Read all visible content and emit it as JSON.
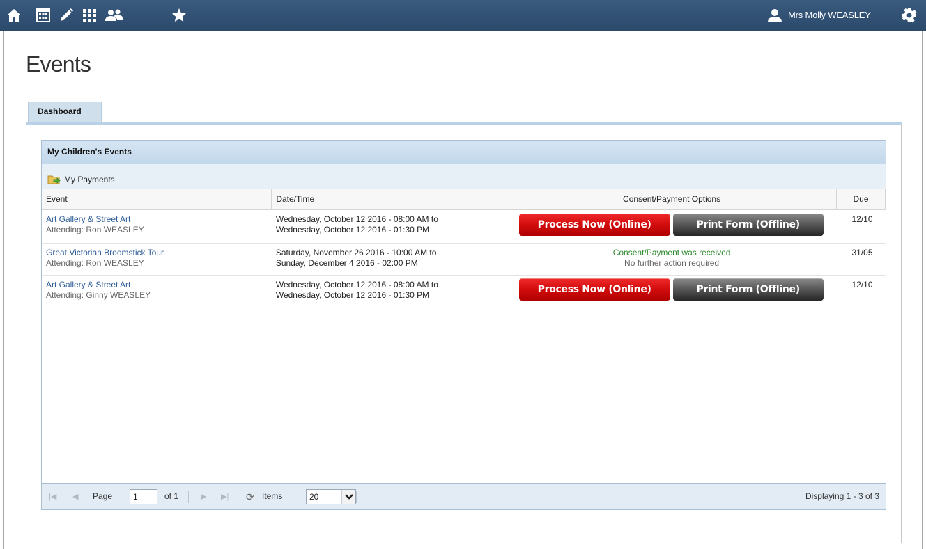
{
  "topbar": {
    "icons": [
      "home-icon",
      "calendar-icon",
      "pencil-icon",
      "grid-icon",
      "people-icon",
      "star-icon"
    ],
    "user_name": "Mrs Molly WEASLEY",
    "settings_icon": "gear-icon",
    "bar_color": "#2e4f73"
  },
  "page": {
    "title": "Events"
  },
  "tabs": [
    {
      "label": "Dashboard",
      "active": true
    }
  ],
  "grid": {
    "title": "My Children's Events",
    "toolbar_link": "My Payments",
    "columns": [
      "Event",
      "Date/Time",
      "Consent/Payment Options",
      "Due"
    ],
    "rows": [
      {
        "event": "Art Gallery & Street Art",
        "attending": "Attending: Ron WEASLEY",
        "datetime_start": "Wednesday, October 12 2016 - 08:00 AM to",
        "datetime_end": "Wednesday, October 12 2016 - 01:30 PM",
        "button_online": "Process Now (Online)",
        "button_offline": "Print Form (Offline)",
        "due": "12/10"
      },
      {
        "event": "Great Victorian Broomstick Tour",
        "attending": "Attending: Ron WEASLEY",
        "datetime_start": "Saturday, November 26 2016 - 10:00 AM to",
        "datetime_end": "Sunday, December 4 2016 - 02:00 PM",
        "consent_status": "Consent/Payment was received",
        "consent_note": "No further action required",
        "due": "31/05"
      },
      {
        "event": "Art Gallery & Street Art",
        "attending": "Attending: Ginny WEASLEY",
        "datetime_start": "Wednesday, October 12 2016 - 08:00 AM to",
        "datetime_end": "Wednesday, October 12 2016 - 01:30 PM",
        "button_online": "Process Now (Online)",
        "button_offline": "Print Form (Offline)",
        "due": "12/10"
      }
    ],
    "pager": {
      "page_label": "Page",
      "page_value": "1",
      "of_label": "of 1",
      "items_label": "Items",
      "items_value": "20",
      "displaying": "Displaying 1 - 3 of 3"
    },
    "colors": {
      "online_button": "#d10c0c",
      "offline_button": "#444444",
      "received": "#2f8a2f",
      "link": "#2e5d97"
    }
  }
}
